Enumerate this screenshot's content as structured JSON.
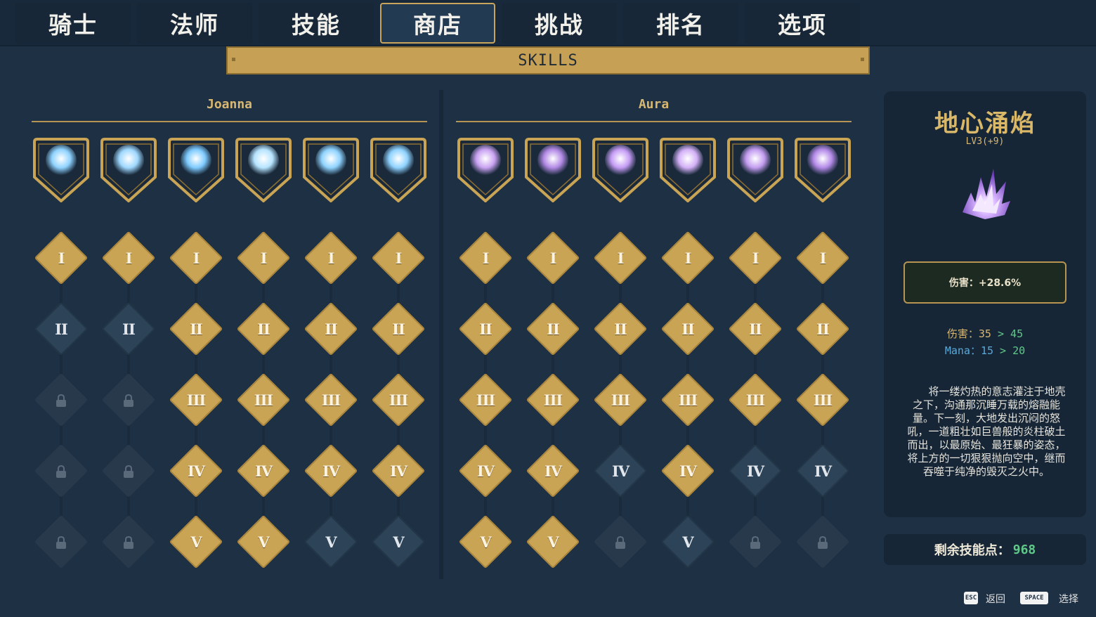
{
  "tabs": [
    "骑士",
    "法师",
    "技能",
    "商店",
    "挑战",
    "排名",
    "选项"
  ],
  "active_tab": 3,
  "banner": "SKILLS",
  "columns": [
    {
      "name": "Joanna",
      "skills": [
        {
          "icon": "sword-slash-icon",
          "color": "#8fd3ff",
          "tiers": [
            "gold",
            "dark",
            "locked",
            "locked",
            "locked"
          ]
        },
        {
          "icon": "holy-ankh-icon",
          "color": "#9fd8ff",
          "tiers": [
            "gold",
            "dark",
            "locked",
            "locked",
            "locked"
          ]
        },
        {
          "icon": "dash-strike-icon",
          "color": "#7ecbff",
          "tiers": [
            "gold",
            "gold",
            "gold",
            "gold",
            "gold"
          ]
        },
        {
          "icon": "spirit-shield-icon",
          "color": "#b6e4ff",
          "tiers": [
            "gold",
            "gold",
            "gold",
            "gold",
            "gold"
          ]
        },
        {
          "icon": "wing-wave-icon",
          "color": "#8fd3ff",
          "tiers": [
            "gold",
            "gold",
            "gold",
            "gold",
            "dark"
          ]
        },
        {
          "icon": "whirlwind-icon",
          "color": "#8fd3ff",
          "tiers": [
            "gold",
            "gold",
            "gold",
            "gold",
            "dark"
          ]
        }
      ]
    },
    {
      "name": "Aura",
      "skills": [
        {
          "icon": "arcane-tome-icon",
          "color": "#c9a2f2",
          "tiers": [
            "gold",
            "gold",
            "gold",
            "gold",
            "gold"
          ]
        },
        {
          "icon": "violet-burst-icon",
          "color": "#b38ae6",
          "tiers": [
            "gold",
            "gold",
            "gold",
            "gold",
            "gold"
          ]
        },
        {
          "icon": "earth-spike-icon",
          "color": "#c59cf5",
          "tiers": [
            "gold",
            "gold",
            "gold",
            "dark",
            "locked"
          ]
        },
        {
          "icon": "vortex-orb-icon",
          "color": "#d3b0f7",
          "tiers": [
            "gold",
            "gold",
            "gold",
            "gold",
            "dark"
          ]
        },
        {
          "icon": "crystal-sigil-icon",
          "color": "#c39cf0",
          "tiers": [
            "gold",
            "gold",
            "gold",
            "dark",
            "locked"
          ]
        },
        {
          "icon": "purple-flame-icon",
          "color": "#b48ae8",
          "tiers": [
            "gold",
            "gold",
            "gold",
            "dark",
            "locked"
          ]
        }
      ]
    }
  ],
  "tier_labels": [
    "I",
    "II",
    "III",
    "IV",
    "V"
  ],
  "detail": {
    "title": "地心涌焰",
    "level": "LV3(+9)",
    "icon": "earth-spike-icon",
    "bonus": "伤害：+28.6%",
    "stat_damage": {
      "label": "伤害：",
      "from": "35",
      "arrow": ">",
      "to": "45",
      "color": "#d7b772",
      "to_color": "#5fc98a"
    },
    "stat_mana": {
      "label": "Mana：",
      "from": "15",
      "arrow": ">",
      "to": "20",
      "color": "#5aa9d9",
      "to_color": "#5fc98a"
    },
    "description": "将一缕灼热的意志灌注于地壳之下，沟通那沉睡万载的熔融能量。下一刻，大地发出沉闷的怒吼，一道粗壮如巨兽般的炎柱破土而出，以最原始、最狂暴的姿态，将上方的一切狠狠抛向空中，继而吞噬于纯净的毁灭之火中。"
  },
  "points": {
    "label": "剩余技能点：",
    "value": "968"
  },
  "controls": [
    {
      "key": "ESC",
      "label": "返回"
    },
    {
      "key": "SPACE",
      "label": "选择"
    }
  ],
  "colors": {
    "gold": "#c9a455",
    "dark": "#2c4358",
    "locked": "#27394b",
    "background": "#1d3044"
  }
}
